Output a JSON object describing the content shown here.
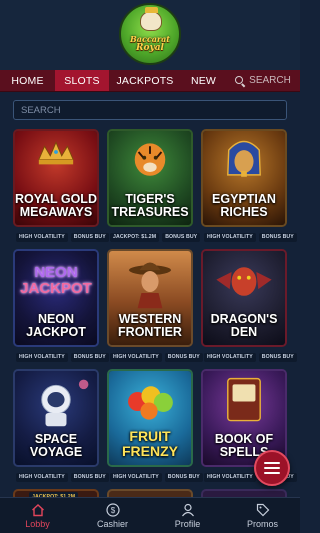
{
  "brand": {
    "line1": "Baccarat",
    "line2": "Royal"
  },
  "nav": {
    "items": [
      "HOME",
      "SLOTS",
      "JACKPOTS",
      "NEW"
    ],
    "active": "SLOTS",
    "search_label": "SEARCH"
  },
  "search": {
    "placeholder": "SEARCH"
  },
  "games": [
    {
      "title": "ROYAL GOLD MEGAWAYS",
      "tags": [
        "HIGH VOLATILITY",
        "BONUS BUY"
      ]
    },
    {
      "title": "TIGER'S TREASURES",
      "tags": [
        "JACKPOT: $1.2M",
        "BONUS BUY"
      ]
    },
    {
      "title": "EGYPTIAN RICHES",
      "tags": [
        "HIGH VOLATILITY",
        "BONUS BUY"
      ]
    },
    {
      "title": "NEON JACKPOT",
      "tags": [
        "HIGH VOLATILITY",
        "BONUS BUY"
      ]
    },
    {
      "title": "WESTERN FRONTIER",
      "tags": [
        "HIGH VOLATILITY",
        "BONUS BUY"
      ]
    },
    {
      "title": "DRAGON'S DEN",
      "tags": [
        "HIGH VOLATILITY",
        "BONUS BUY"
      ]
    },
    {
      "title": "SPACE VOYAGE",
      "tags": [
        "HIGH VOLATILITY",
        "BONUS BUY"
      ]
    },
    {
      "title": "FRUIT FRENZY",
      "tags": [
        "HIGH VOLATILITY",
        "BONUS BUY"
      ]
    },
    {
      "title": "BOOK OF SPELLS",
      "tags": [
        "HIGH VOLATILITY",
        "BONUS BUY"
      ]
    }
  ],
  "partial_row": {
    "badge": "JACKPOT: $1.2M"
  },
  "bottom_nav": [
    {
      "label": "Lobby",
      "icon": "home-icon",
      "active": true
    },
    {
      "label": "Cashier",
      "icon": "dollar-icon",
      "active": false
    },
    {
      "label": "Profile",
      "icon": "user-icon",
      "active": false
    },
    {
      "label": "Promos",
      "icon": "tag-icon",
      "active": false
    }
  ],
  "colors": {
    "background": "#142238",
    "nav_bar": "#5a0f1e",
    "nav_active": "#a3152f",
    "accent": "#e0455b"
  }
}
